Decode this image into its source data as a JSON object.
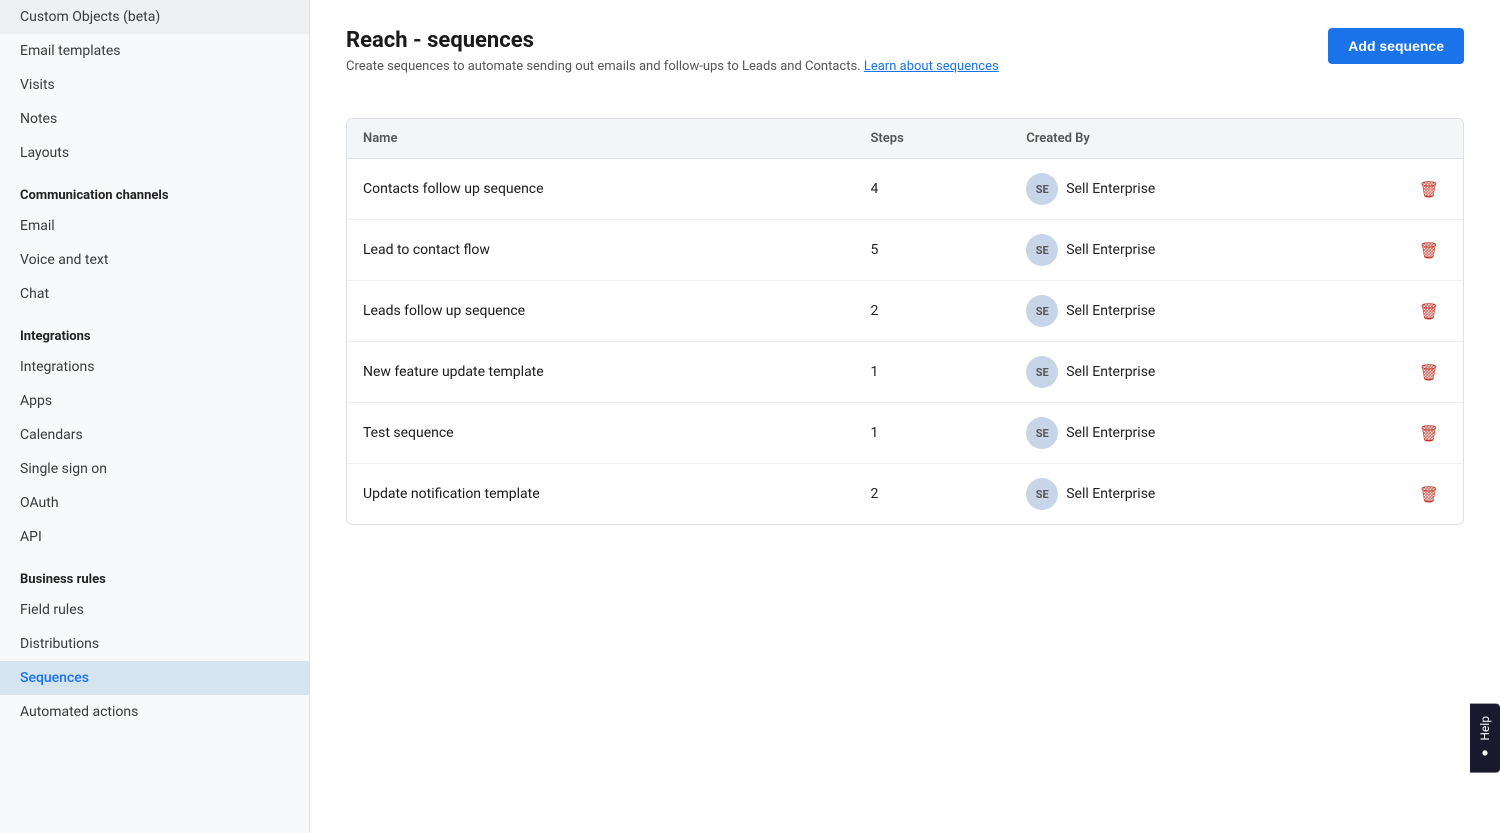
{
  "sidebar": {
    "items_top": [
      {
        "id": "custom-objects",
        "label": "Custom Objects (beta)",
        "active": false
      },
      {
        "id": "email-templates",
        "label": "Email templates",
        "active": false
      },
      {
        "id": "visits",
        "label": "Visits",
        "active": false
      },
      {
        "id": "notes",
        "label": "Notes",
        "active": false
      },
      {
        "id": "layouts",
        "label": "Layouts",
        "active": false
      }
    ],
    "sections": [
      {
        "id": "communication-channels",
        "header": "Communication channels",
        "items": [
          {
            "id": "email",
            "label": "Email",
            "active": false
          },
          {
            "id": "voice-and-text",
            "label": "Voice and text",
            "active": false
          },
          {
            "id": "chat",
            "label": "Chat",
            "active": false
          }
        ]
      },
      {
        "id": "integrations",
        "header": "Integrations",
        "items": [
          {
            "id": "integrations",
            "label": "Integrations",
            "active": false
          },
          {
            "id": "apps",
            "label": "Apps",
            "active": false
          },
          {
            "id": "calendars",
            "label": "Calendars",
            "active": false
          },
          {
            "id": "single-sign-on",
            "label": "Single sign on",
            "active": false
          },
          {
            "id": "oauth",
            "label": "OAuth",
            "active": false
          },
          {
            "id": "api",
            "label": "API",
            "active": false
          }
        ]
      },
      {
        "id": "business-rules",
        "header": "Business rules",
        "items": [
          {
            "id": "field-rules",
            "label": "Field rules",
            "active": false
          },
          {
            "id": "distributions",
            "label": "Distributions",
            "active": false
          },
          {
            "id": "sequences",
            "label": "Sequences",
            "active": true
          },
          {
            "id": "automated-actions",
            "label": "Automated actions",
            "active": false
          }
        ]
      }
    ]
  },
  "main": {
    "title": "Reach - sequences",
    "description": "Create sequences to automate sending out emails and follow-ups to Leads and Contacts.",
    "learn_link": "Learn about sequences",
    "add_button": "Add sequence",
    "table": {
      "columns": [
        "Name",
        "Steps",
        "Created By",
        ""
      ],
      "rows": [
        {
          "id": 1,
          "name": "Contacts follow up sequence",
          "steps": "4",
          "created_by": "Sell Enterprise",
          "avatar": "SE"
        },
        {
          "id": 2,
          "name": "Lead to contact flow",
          "steps": "5",
          "created_by": "Sell Enterprise",
          "avatar": "SE"
        },
        {
          "id": 3,
          "name": "Leads follow up sequence",
          "steps": "2",
          "created_by": "Sell Enterprise",
          "avatar": "SE"
        },
        {
          "id": 4,
          "name": "New feature update template",
          "steps": "1",
          "created_by": "Sell Enterprise",
          "avatar": "SE"
        },
        {
          "id": 5,
          "name": "Test sequence",
          "steps": "1",
          "created_by": "Sell Enterprise",
          "avatar": "SE"
        },
        {
          "id": 6,
          "name": "Update notification template",
          "steps": "2",
          "created_by": "Sell Enterprise",
          "avatar": "SE"
        }
      ]
    }
  },
  "help_button": "Help"
}
